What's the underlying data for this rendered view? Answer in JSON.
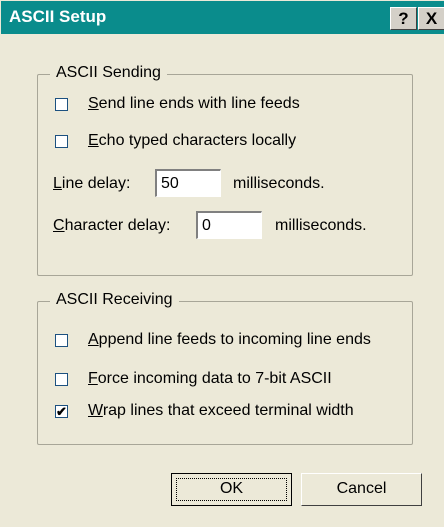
{
  "window": {
    "title": "ASCII Setup",
    "help_label": "?",
    "close_label": "X"
  },
  "sending": {
    "legend": "ASCII Sending",
    "send_line_ends": {
      "hotkey": "S",
      "rest": "end line ends with line feeds",
      "checked": false
    },
    "echo_typed": {
      "hotkey": "E",
      "rest": "cho typed characters locally",
      "checked": false
    },
    "line_delay": {
      "hotkey": "L",
      "rest": "ine delay:",
      "value": "50",
      "unit": "milliseconds."
    },
    "character_delay": {
      "hotkey": "C",
      "rest": "haracter delay:",
      "value": "0",
      "unit": "milliseconds."
    }
  },
  "receiving": {
    "legend": "ASCII Receiving",
    "append_line_feeds": {
      "hotkey": "A",
      "rest": "ppend line feeds to incoming line ends",
      "checked": false
    },
    "force_7bit": {
      "hotkey": "F",
      "rest": "orce incoming data to 7-bit ASCII",
      "checked": false
    },
    "wrap_lines": {
      "hotkey": "W",
      "rest": "rap lines that exceed terminal width",
      "checked": true
    }
  },
  "buttons": {
    "ok": "OK",
    "cancel": "Cancel"
  },
  "glyphs": {
    "check": "✔"
  }
}
